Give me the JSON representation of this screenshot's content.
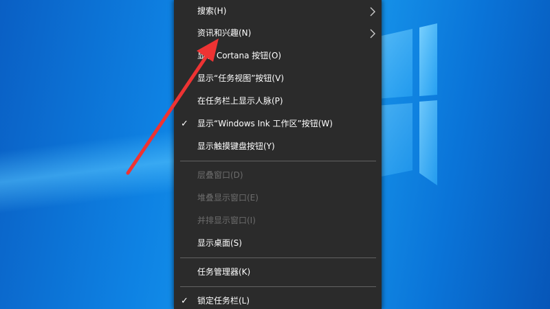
{
  "colors": {
    "desktop_blue": "#0e82e3",
    "menu_bg": "#2b2b2b",
    "menu_text": "#ffffff",
    "menu_disabled_text": "#6d6d6d",
    "separator": "#636363",
    "annotation_arrow": "#ee3333"
  },
  "icons": {
    "check": "✓",
    "submenu_arrow": "chevron-right-icon",
    "windows_logo": "windows-logo-icon",
    "annotation": "red-arrow-icon"
  },
  "menu": {
    "items": [
      {
        "label": "搜索(H)",
        "checked": false,
        "disabled": false,
        "submenu": true
      },
      {
        "label": "资讯和兴趣(N)",
        "checked": false,
        "disabled": false,
        "submenu": true
      },
      {
        "label": "显示 Cortana 按钮(O)",
        "checked": false,
        "disabled": false,
        "submenu": false
      },
      {
        "label": "显示“任务视图”按钮(V)",
        "checked": false,
        "disabled": false,
        "submenu": false
      },
      {
        "label": "在任务栏上显示人脉(P)",
        "checked": false,
        "disabled": false,
        "submenu": false
      },
      {
        "label": "显示“Windows Ink 工作区”按钮(W)",
        "checked": true,
        "disabled": false,
        "submenu": false
      },
      {
        "label": "显示触摸键盘按钮(Y)",
        "checked": false,
        "disabled": false,
        "submenu": false
      },
      {
        "label": "层叠窗口(D)",
        "checked": false,
        "disabled": true,
        "submenu": false
      },
      {
        "label": "堆叠显示窗口(E)",
        "checked": false,
        "disabled": true,
        "submenu": false
      },
      {
        "label": "并排显示窗口(I)",
        "checked": false,
        "disabled": true,
        "submenu": false
      },
      {
        "label": "显示桌面(S)",
        "checked": false,
        "disabled": false,
        "submenu": false
      },
      {
        "label": "任务管理器(K)",
        "checked": false,
        "disabled": false,
        "submenu": false
      },
      {
        "label": "锁定任务栏(L)",
        "checked": true,
        "disabled": false,
        "submenu": false
      }
    ]
  }
}
